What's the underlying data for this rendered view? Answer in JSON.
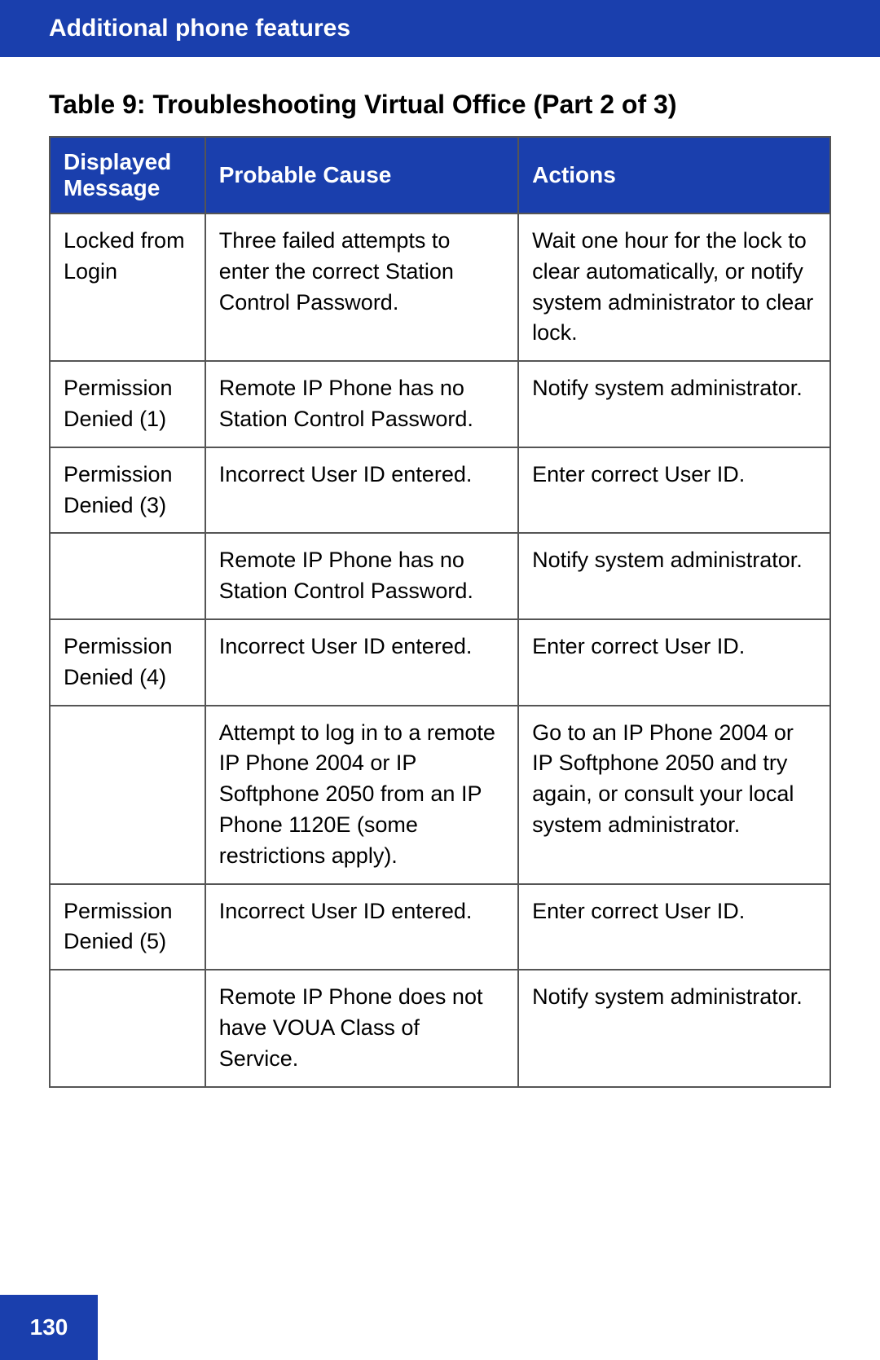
{
  "header": {
    "title": "Additional phone features"
  },
  "table": {
    "caption": "Table 9: Troubleshooting Virtual Office (Part 2 of 3)",
    "columns": [
      {
        "id": "displayed_message",
        "label": "Displayed Message"
      },
      {
        "id": "probable_cause",
        "label": "Probable Cause"
      },
      {
        "id": "actions",
        "label": "Actions"
      }
    ],
    "rows": [
      {
        "message": "Locked from Login",
        "cause": "Three failed attempts to enter the correct Station Control Password.",
        "action": "Wait one hour for the lock to clear automatically, or notify system administrator to clear lock."
      },
      {
        "message": "Permission Denied (1)",
        "cause": "Remote IP Phone has no Station Control Password.",
        "action": "Notify system administrator."
      },
      {
        "message": "Permission Denied (3)",
        "cause": "Incorrect User ID entered.",
        "action": "Enter correct User ID."
      },
      {
        "message": "",
        "cause": "Remote IP Phone has no Station Control Password.",
        "action": "Notify system administrator."
      },
      {
        "message": "Permission Denied (4)",
        "cause": "Incorrect User ID entered.",
        "action": "Enter correct User ID."
      },
      {
        "message": "",
        "cause": "Attempt to log in to a remote IP Phone 2004 or IP Softphone 2050 from an IP Phone 1120E (some restrictions apply).",
        "action": "Go to an IP Phone 2004 or IP Softphone 2050 and try again, or consult your local system administrator."
      },
      {
        "message": "Permission Denied (5)",
        "cause": "Incorrect User ID entered.",
        "action": "Enter correct User ID."
      },
      {
        "message": "",
        "cause": "Remote IP Phone does not have VOUA Class of Service.",
        "action": "Notify system administrator."
      }
    ]
  },
  "footer": {
    "page_number": "130"
  }
}
